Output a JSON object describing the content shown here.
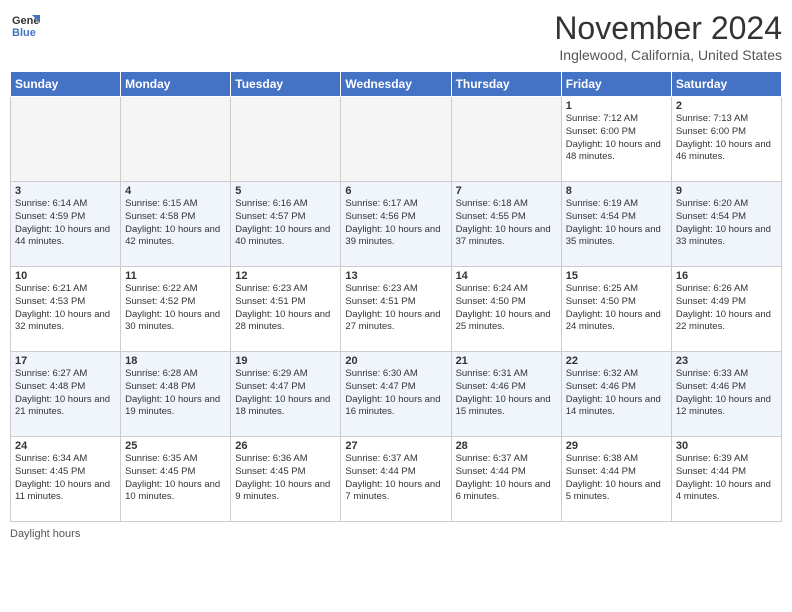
{
  "logo": {
    "text1": "General",
    "text2": "Blue"
  },
  "title": "November 2024",
  "location": "Inglewood, California, United States",
  "days_of_week": [
    "Sunday",
    "Monday",
    "Tuesday",
    "Wednesday",
    "Thursday",
    "Friday",
    "Saturday"
  ],
  "footer": "Daylight hours",
  "weeks": [
    [
      {
        "day": "",
        "info": ""
      },
      {
        "day": "",
        "info": ""
      },
      {
        "day": "",
        "info": ""
      },
      {
        "day": "",
        "info": ""
      },
      {
        "day": "",
        "info": ""
      },
      {
        "day": "1",
        "info": "Sunrise: 7:12 AM\nSunset: 6:00 PM\nDaylight: 10 hours and 48 minutes."
      },
      {
        "day": "2",
        "info": "Sunrise: 7:13 AM\nSunset: 6:00 PM\nDaylight: 10 hours and 46 minutes."
      }
    ],
    [
      {
        "day": "3",
        "info": "Sunrise: 6:14 AM\nSunset: 4:59 PM\nDaylight: 10 hours and 44 minutes."
      },
      {
        "day": "4",
        "info": "Sunrise: 6:15 AM\nSunset: 4:58 PM\nDaylight: 10 hours and 42 minutes."
      },
      {
        "day": "5",
        "info": "Sunrise: 6:16 AM\nSunset: 4:57 PM\nDaylight: 10 hours and 40 minutes."
      },
      {
        "day": "6",
        "info": "Sunrise: 6:17 AM\nSunset: 4:56 PM\nDaylight: 10 hours and 39 minutes."
      },
      {
        "day": "7",
        "info": "Sunrise: 6:18 AM\nSunset: 4:55 PM\nDaylight: 10 hours and 37 minutes."
      },
      {
        "day": "8",
        "info": "Sunrise: 6:19 AM\nSunset: 4:54 PM\nDaylight: 10 hours and 35 minutes."
      },
      {
        "day": "9",
        "info": "Sunrise: 6:20 AM\nSunset: 4:54 PM\nDaylight: 10 hours and 33 minutes."
      }
    ],
    [
      {
        "day": "10",
        "info": "Sunrise: 6:21 AM\nSunset: 4:53 PM\nDaylight: 10 hours and 32 minutes."
      },
      {
        "day": "11",
        "info": "Sunrise: 6:22 AM\nSunset: 4:52 PM\nDaylight: 10 hours and 30 minutes."
      },
      {
        "day": "12",
        "info": "Sunrise: 6:23 AM\nSunset: 4:51 PM\nDaylight: 10 hours and 28 minutes."
      },
      {
        "day": "13",
        "info": "Sunrise: 6:23 AM\nSunset: 4:51 PM\nDaylight: 10 hours and 27 minutes."
      },
      {
        "day": "14",
        "info": "Sunrise: 6:24 AM\nSunset: 4:50 PM\nDaylight: 10 hours and 25 minutes."
      },
      {
        "day": "15",
        "info": "Sunrise: 6:25 AM\nSunset: 4:50 PM\nDaylight: 10 hours and 24 minutes."
      },
      {
        "day": "16",
        "info": "Sunrise: 6:26 AM\nSunset: 4:49 PM\nDaylight: 10 hours and 22 minutes."
      }
    ],
    [
      {
        "day": "17",
        "info": "Sunrise: 6:27 AM\nSunset: 4:48 PM\nDaylight: 10 hours and 21 minutes."
      },
      {
        "day": "18",
        "info": "Sunrise: 6:28 AM\nSunset: 4:48 PM\nDaylight: 10 hours and 19 minutes."
      },
      {
        "day": "19",
        "info": "Sunrise: 6:29 AM\nSunset: 4:47 PM\nDaylight: 10 hours and 18 minutes."
      },
      {
        "day": "20",
        "info": "Sunrise: 6:30 AM\nSunset: 4:47 PM\nDaylight: 10 hours and 16 minutes."
      },
      {
        "day": "21",
        "info": "Sunrise: 6:31 AM\nSunset: 4:46 PM\nDaylight: 10 hours and 15 minutes."
      },
      {
        "day": "22",
        "info": "Sunrise: 6:32 AM\nSunset: 4:46 PM\nDaylight: 10 hours and 14 minutes."
      },
      {
        "day": "23",
        "info": "Sunrise: 6:33 AM\nSunset: 4:46 PM\nDaylight: 10 hours and 12 minutes."
      }
    ],
    [
      {
        "day": "24",
        "info": "Sunrise: 6:34 AM\nSunset: 4:45 PM\nDaylight: 10 hours and 11 minutes."
      },
      {
        "day": "25",
        "info": "Sunrise: 6:35 AM\nSunset: 4:45 PM\nDaylight: 10 hours and 10 minutes."
      },
      {
        "day": "26",
        "info": "Sunrise: 6:36 AM\nSunset: 4:45 PM\nDaylight: 10 hours and 9 minutes."
      },
      {
        "day": "27",
        "info": "Sunrise: 6:37 AM\nSunset: 4:44 PM\nDaylight: 10 hours and 7 minutes."
      },
      {
        "day": "28",
        "info": "Sunrise: 6:37 AM\nSunset: 4:44 PM\nDaylight: 10 hours and 6 minutes."
      },
      {
        "day": "29",
        "info": "Sunrise: 6:38 AM\nSunset: 4:44 PM\nDaylight: 10 hours and 5 minutes."
      },
      {
        "day": "30",
        "info": "Sunrise: 6:39 AM\nSunset: 4:44 PM\nDaylight: 10 hours and 4 minutes."
      }
    ]
  ]
}
